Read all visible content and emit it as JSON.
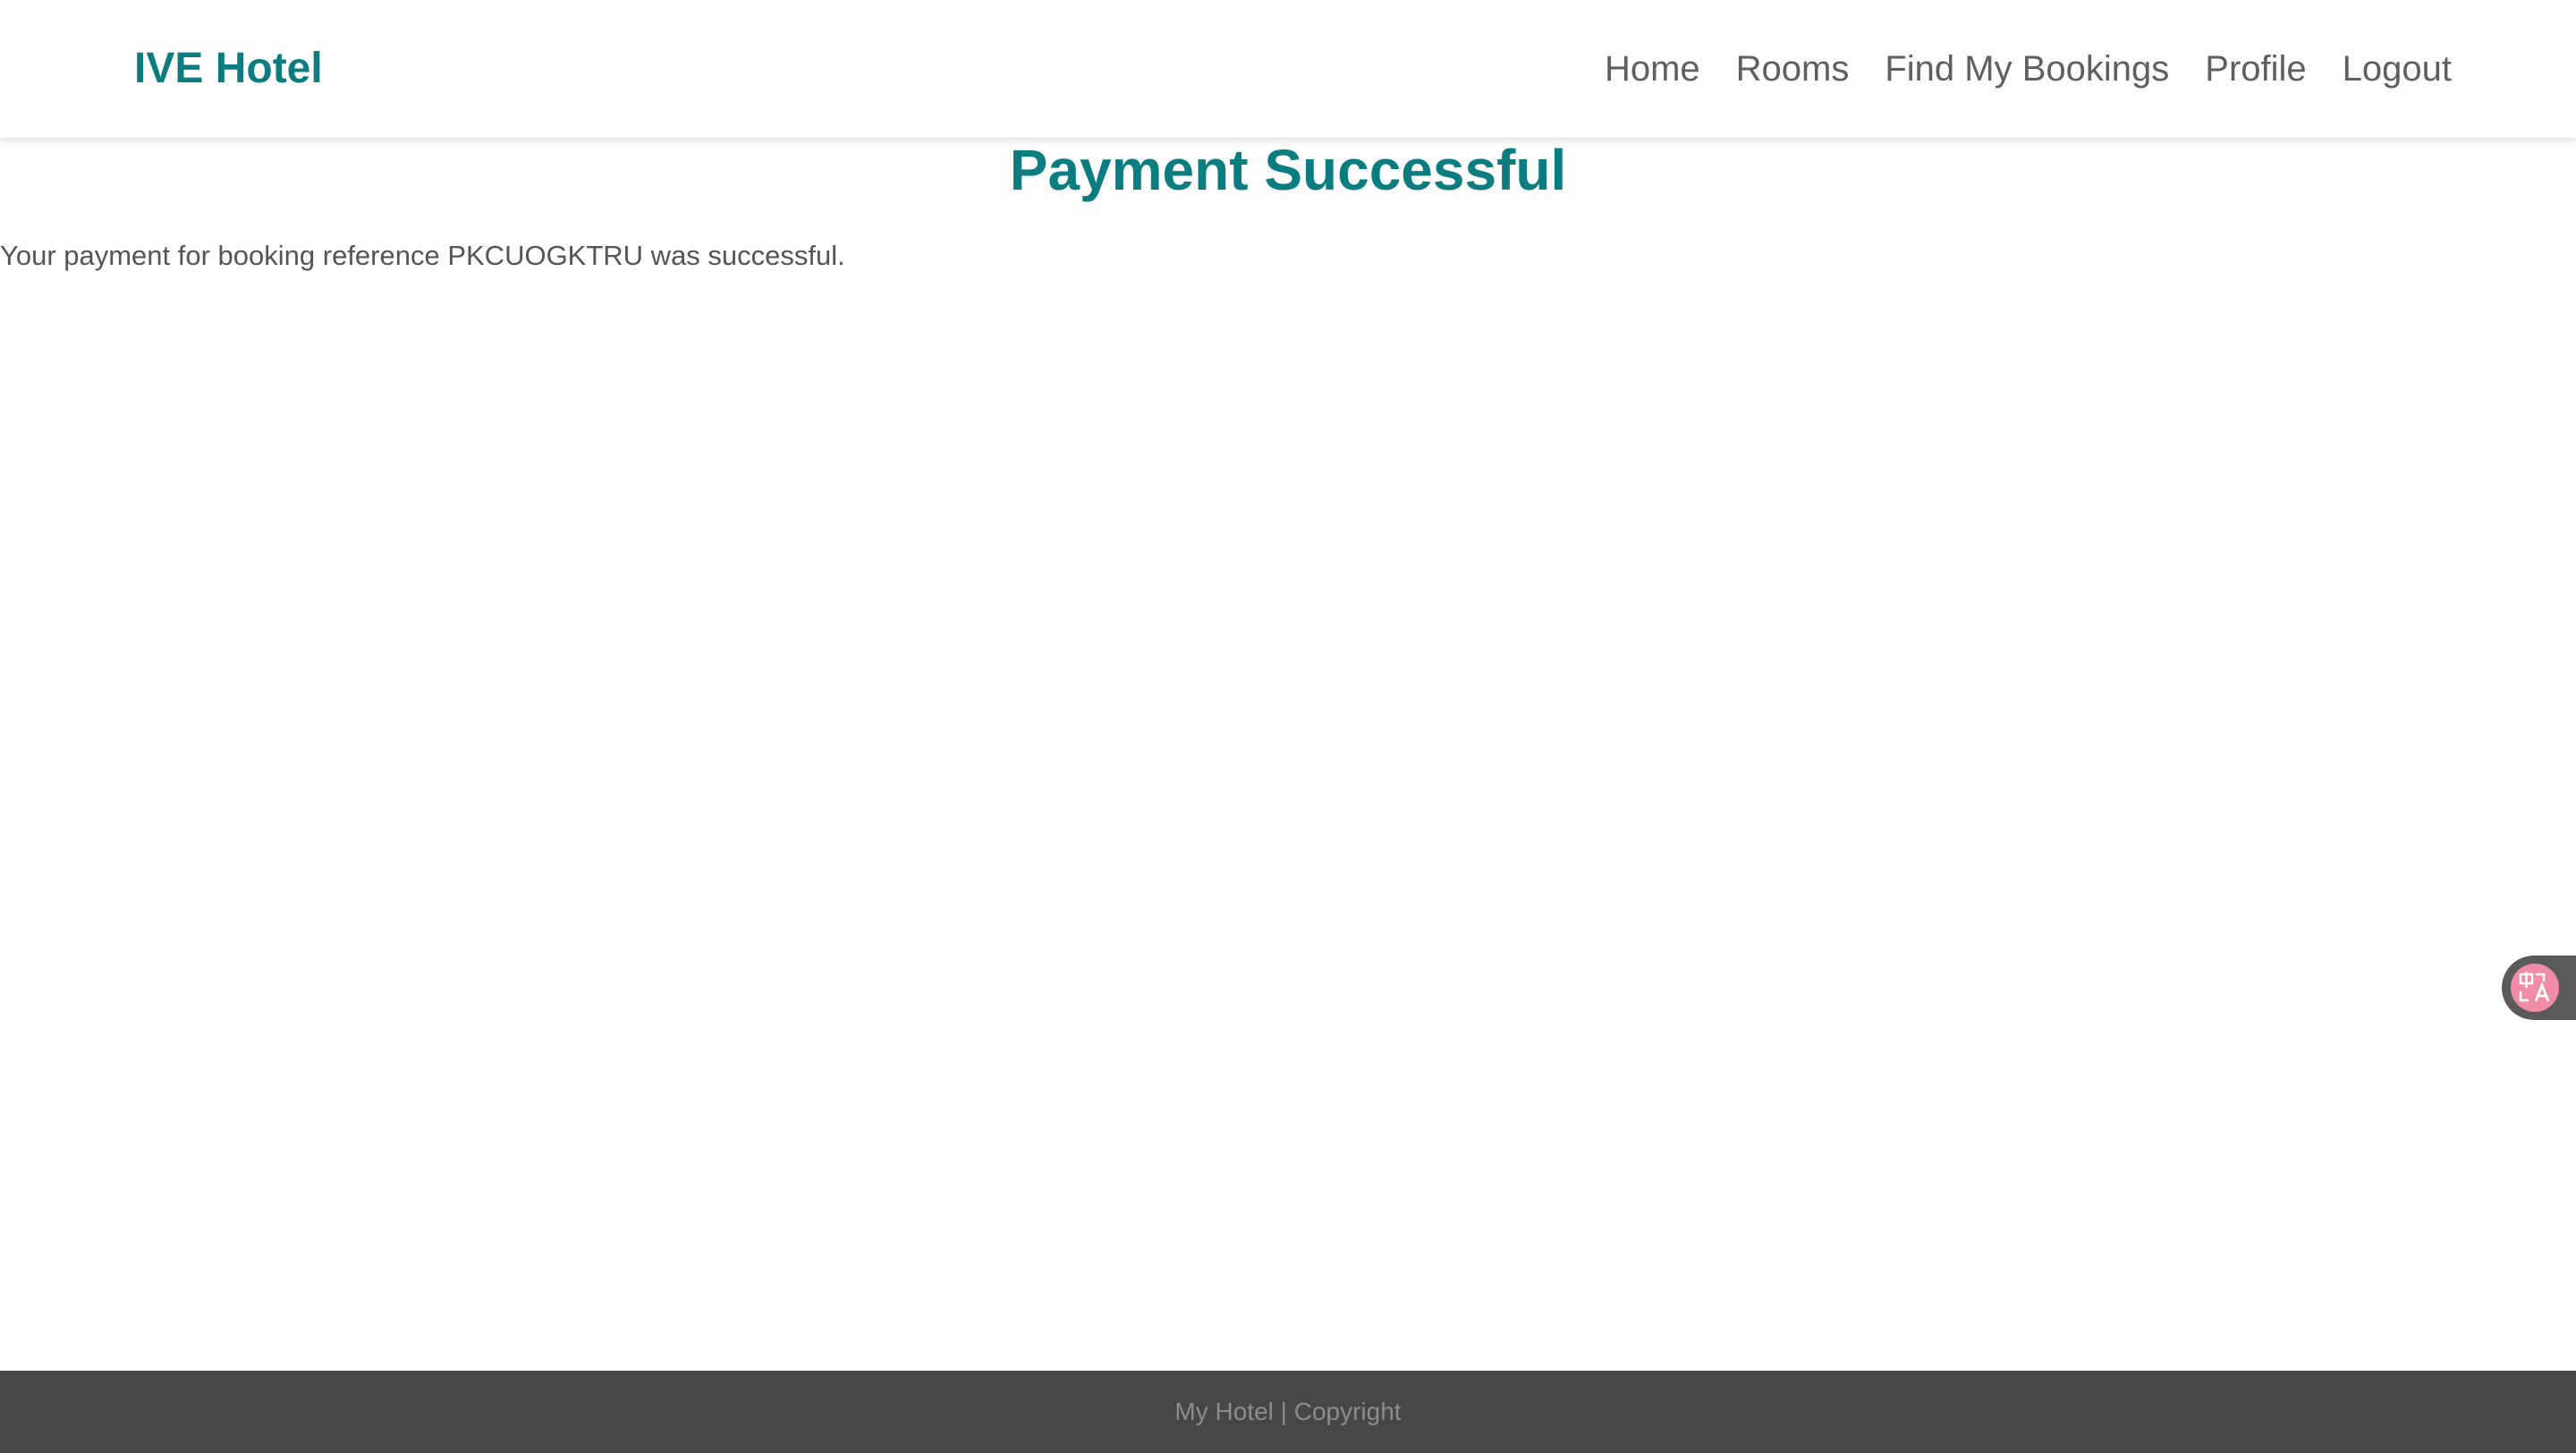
{
  "header": {
    "brand": "IVE Hotel",
    "nav": [
      {
        "label": "Home"
      },
      {
        "label": "Rooms"
      },
      {
        "label": "Find My Bookings"
      },
      {
        "label": "Profile"
      },
      {
        "label": "Logout"
      }
    ]
  },
  "main": {
    "title": "Payment Successful",
    "message": "Your payment for booking reference PKCUOGKTRU was successful."
  },
  "footer": {
    "text": "My Hotel | Copyright"
  },
  "widgets": {
    "translate_icon": "translate-icon"
  },
  "colors": {
    "accent": "#0b7c80",
    "nav_text": "#5f5f5f",
    "body_text": "#555555",
    "footer_bg": "#464646",
    "footer_text": "#8c8c8c",
    "translate_badge": "#f08ca6"
  }
}
